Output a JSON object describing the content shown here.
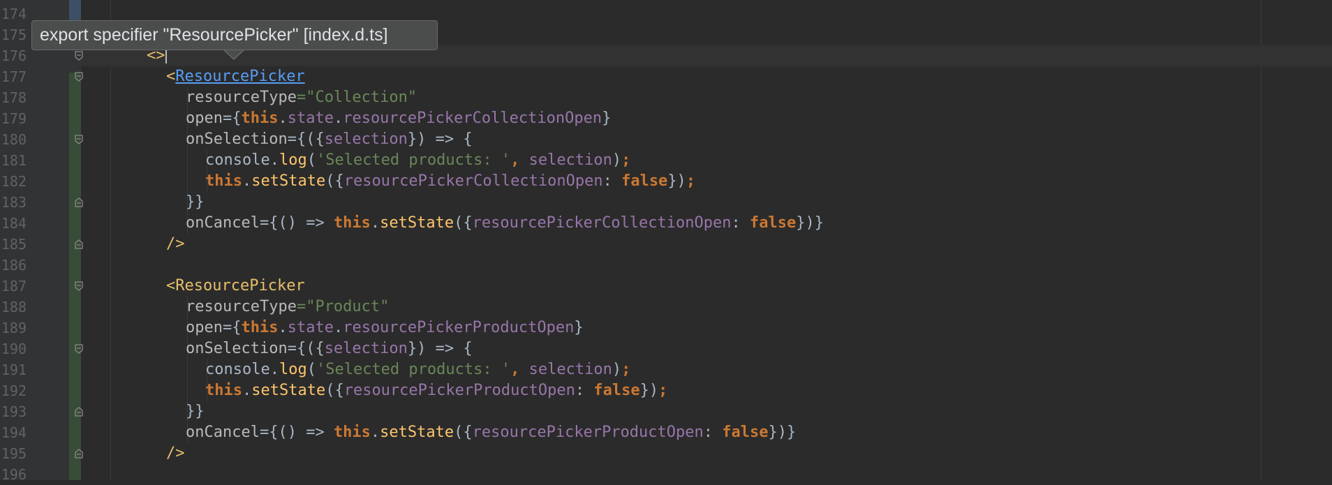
{
  "tooltip": {
    "text": "export specifier \"ResourcePicker\" [index.d.ts]"
  },
  "lines": [
    {
      "num": "174",
      "indent": 0,
      "fold": "",
      "tokens": []
    },
    {
      "num": "175",
      "indent": 0,
      "fold": "",
      "tokens": []
    },
    {
      "num": "176",
      "indent": 0,
      "fold": "open",
      "tokens": [
        [
          "tag",
          "<>"
        ]
      ]
    },
    {
      "num": "177",
      "indent": 1,
      "fold": "open",
      "tokens": [
        [
          "tag",
          "<"
        ],
        [
          "link",
          "ResourcePicker"
        ]
      ]
    },
    {
      "num": "178",
      "indent": 2,
      "fold": "",
      "tokens": [
        [
          "attr",
          "resourceType"
        ],
        [
          "str",
          "=\"Collection\""
        ]
      ]
    },
    {
      "num": "179",
      "indent": 2,
      "fold": "",
      "tokens": [
        [
          "attr",
          "open"
        ],
        [
          "punc",
          "={"
        ],
        [
          "kw",
          "this"
        ],
        [
          "punc",
          "."
        ],
        [
          "prop",
          "state"
        ],
        [
          "punc",
          "."
        ],
        [
          "prop",
          "resourcePickerCollectionOpen"
        ],
        [
          "punc",
          "}"
        ]
      ]
    },
    {
      "num": "180",
      "indent": 2,
      "fold": "open",
      "tokens": [
        [
          "attr",
          "onSelection"
        ],
        [
          "punc",
          "={({"
        ],
        [
          "prop",
          "selection"
        ],
        [
          "punc",
          "}) => {"
        ]
      ]
    },
    {
      "num": "181",
      "indent": 3,
      "fold": "",
      "tokens": [
        [
          "punc",
          "console."
        ],
        [
          "fn",
          "log"
        ],
        [
          "punc",
          "("
        ],
        [
          "str",
          "'Selected products: '"
        ],
        [
          "kw",
          ","
        ],
        [
          "punc",
          " "
        ],
        [
          "prop",
          "selection"
        ],
        [
          "punc",
          ")"
        ],
        [
          "kw",
          ";"
        ]
      ]
    },
    {
      "num": "182",
      "indent": 3,
      "fold": "",
      "tokens": [
        [
          "kw",
          "this"
        ],
        [
          "punc",
          "."
        ],
        [
          "fn",
          "setState"
        ],
        [
          "punc",
          "({"
        ],
        [
          "prop",
          "resourcePickerCollectionOpen"
        ],
        [
          "punc",
          ": "
        ],
        [
          "kw",
          "false"
        ],
        [
          "punc",
          "})"
        ],
        [
          "kw",
          ";"
        ]
      ]
    },
    {
      "num": "183",
      "indent": 2,
      "fold": "close",
      "tokens": [
        [
          "punc",
          "}}"
        ]
      ]
    },
    {
      "num": "184",
      "indent": 2,
      "fold": "",
      "tokens": [
        [
          "attr",
          "onCancel"
        ],
        [
          "punc",
          "={() => "
        ],
        [
          "kw",
          "this"
        ],
        [
          "punc",
          "."
        ],
        [
          "fn",
          "setState"
        ],
        [
          "punc",
          "({"
        ],
        [
          "prop",
          "resourcePickerCollectionOpen"
        ],
        [
          "punc",
          ": "
        ],
        [
          "kw",
          "false"
        ],
        [
          "punc",
          "})}"
        ]
      ]
    },
    {
      "num": "185",
      "indent": 1,
      "fold": "close",
      "tokens": [
        [
          "tag",
          "/>"
        ]
      ]
    },
    {
      "num": "186",
      "indent": 0,
      "fold": "",
      "tokens": []
    },
    {
      "num": "187",
      "indent": 1,
      "fold": "open",
      "tokens": [
        [
          "tag",
          "<"
        ],
        [
          "tagname",
          "ResourcePicker"
        ]
      ]
    },
    {
      "num": "188",
      "indent": 2,
      "fold": "",
      "tokens": [
        [
          "attr",
          "resourceType"
        ],
        [
          "str",
          "=\"Product\""
        ]
      ]
    },
    {
      "num": "189",
      "indent": 2,
      "fold": "",
      "tokens": [
        [
          "attr",
          "open"
        ],
        [
          "punc",
          "={"
        ],
        [
          "kw",
          "this"
        ],
        [
          "punc",
          "."
        ],
        [
          "prop",
          "state"
        ],
        [
          "punc",
          "."
        ],
        [
          "prop",
          "resourcePickerProductOpen"
        ],
        [
          "punc",
          "}"
        ]
      ]
    },
    {
      "num": "190",
      "indent": 2,
      "fold": "open",
      "tokens": [
        [
          "attr",
          "onSelection"
        ],
        [
          "punc",
          "={({"
        ],
        [
          "prop",
          "selection"
        ],
        [
          "punc",
          "}) => {"
        ]
      ]
    },
    {
      "num": "191",
      "indent": 3,
      "fold": "",
      "tokens": [
        [
          "punc",
          "console."
        ],
        [
          "fn",
          "log"
        ],
        [
          "punc",
          "("
        ],
        [
          "str",
          "'Selected products: '"
        ],
        [
          "kw",
          ","
        ],
        [
          "punc",
          " "
        ],
        [
          "prop",
          "selection"
        ],
        [
          "punc",
          ")"
        ],
        [
          "kw",
          ";"
        ]
      ]
    },
    {
      "num": "192",
      "indent": 3,
      "fold": "",
      "tokens": [
        [
          "kw",
          "this"
        ],
        [
          "punc",
          "."
        ],
        [
          "fn",
          "setState"
        ],
        [
          "punc",
          "({"
        ],
        [
          "prop",
          "resourcePickerProductOpen"
        ],
        [
          "punc",
          ": "
        ],
        [
          "kw",
          "false"
        ],
        [
          "punc",
          "})"
        ],
        [
          "kw",
          ";"
        ]
      ]
    },
    {
      "num": "193",
      "indent": 2,
      "fold": "close",
      "tokens": [
        [
          "punc",
          "}}"
        ]
      ]
    },
    {
      "num": "194",
      "indent": 2,
      "fold": "",
      "tokens": [
        [
          "attr",
          "onCancel"
        ],
        [
          "punc",
          "={() => "
        ],
        [
          "kw",
          "this"
        ],
        [
          "punc",
          "."
        ],
        [
          "fn",
          "setState"
        ],
        [
          "punc",
          "({"
        ],
        [
          "prop",
          "resourcePickerProductOpen"
        ],
        [
          "punc",
          ": "
        ],
        [
          "kw",
          "false"
        ],
        [
          "punc",
          "})}"
        ]
      ]
    },
    {
      "num": "195",
      "indent": 1,
      "fold": "close",
      "tokens": [
        [
          "tag",
          "/>"
        ]
      ]
    },
    {
      "num": "196",
      "indent": 0,
      "fold": "",
      "tokens": []
    }
  ]
}
